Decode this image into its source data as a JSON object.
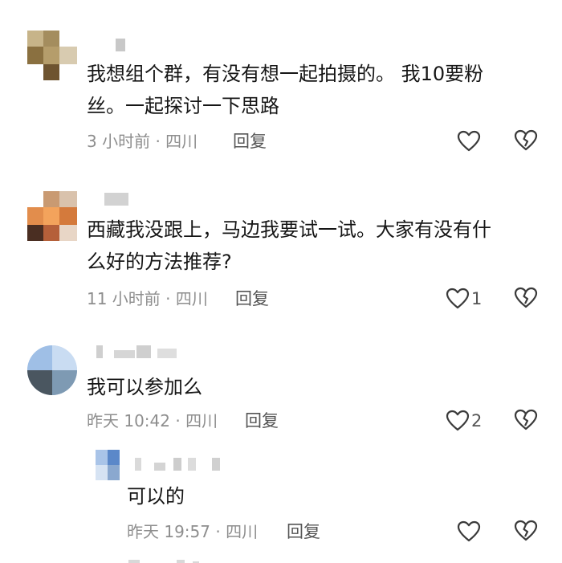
{
  "comments": [
    {
      "text": "我想组个群，有没有想一起拍摄的。 我10要粉\n丝。一起探讨一下思路",
      "time": "3 小时前 · 四川",
      "reply_label": "回复",
      "likes": ""
    },
    {
      "text": "西藏我没跟上，马边我要试一试。大家有没有什\n么好的方法推荐?",
      "time": "11 小时前 · 四川",
      "reply_label": "回复",
      "likes": "1"
    },
    {
      "text": "我可以参加么",
      "time": "昨天 10:42 · 四川",
      "reply_label": "回复",
      "likes": "2"
    },
    {
      "text": "可以的",
      "time": "昨天 19:57 · 四川",
      "reply_label": "回复",
      "likes": ""
    }
  ],
  "icons": {
    "like": "heart-outline-icon",
    "dislike": "broken-heart-icon"
  },
  "colors": {
    "text": "#161616",
    "meta": "#8e8e8e",
    "icon": "#3a3a3a"
  }
}
